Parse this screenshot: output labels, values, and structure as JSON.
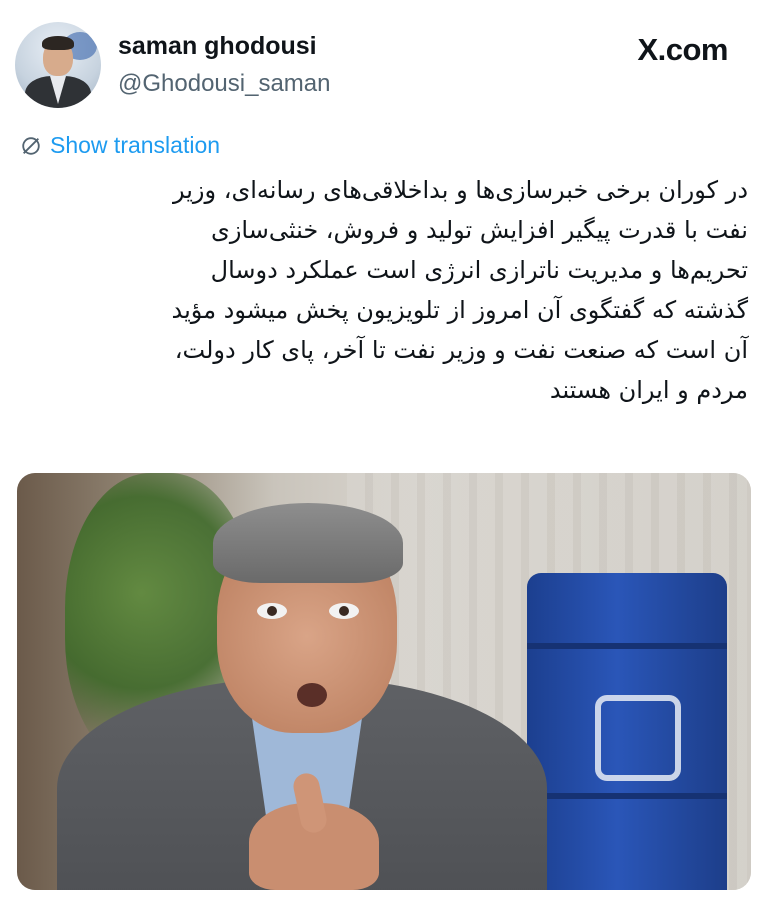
{
  "header": {
    "display_name": "saman ghodousi",
    "handle": "@Ghodousi_saman",
    "brand": "X.com"
  },
  "translation": {
    "label": "Show translation",
    "icon": "globe-slash-icon",
    "color": "#1d9bf0"
  },
  "tweet": {
    "lines": [
      "در کوران برخی خبرسازی‌ها و بداخلاقی‌های  رسانه‌ای، وزیر",
      "نفت با قدرت پیگیر افزایش تولید و فروش، خنثی‌سازی",
      "تحریم‌ها و مدیریت ناترازی انرژی است عملکرد دوسال",
      "گذشته که گفتگوی آن امروز از تلویزیون پخش میشود مؤید",
      "آن است که صنعت نفت و وزیر نفت تا آخر، پای کار دولت،",
      "مردم و ایران هستند"
    ]
  },
  "media": {
    "type": "image"
  },
  "colors": {
    "text": "#0f1419",
    "secondary": "#536471",
    "link": "#1d9bf0"
  }
}
